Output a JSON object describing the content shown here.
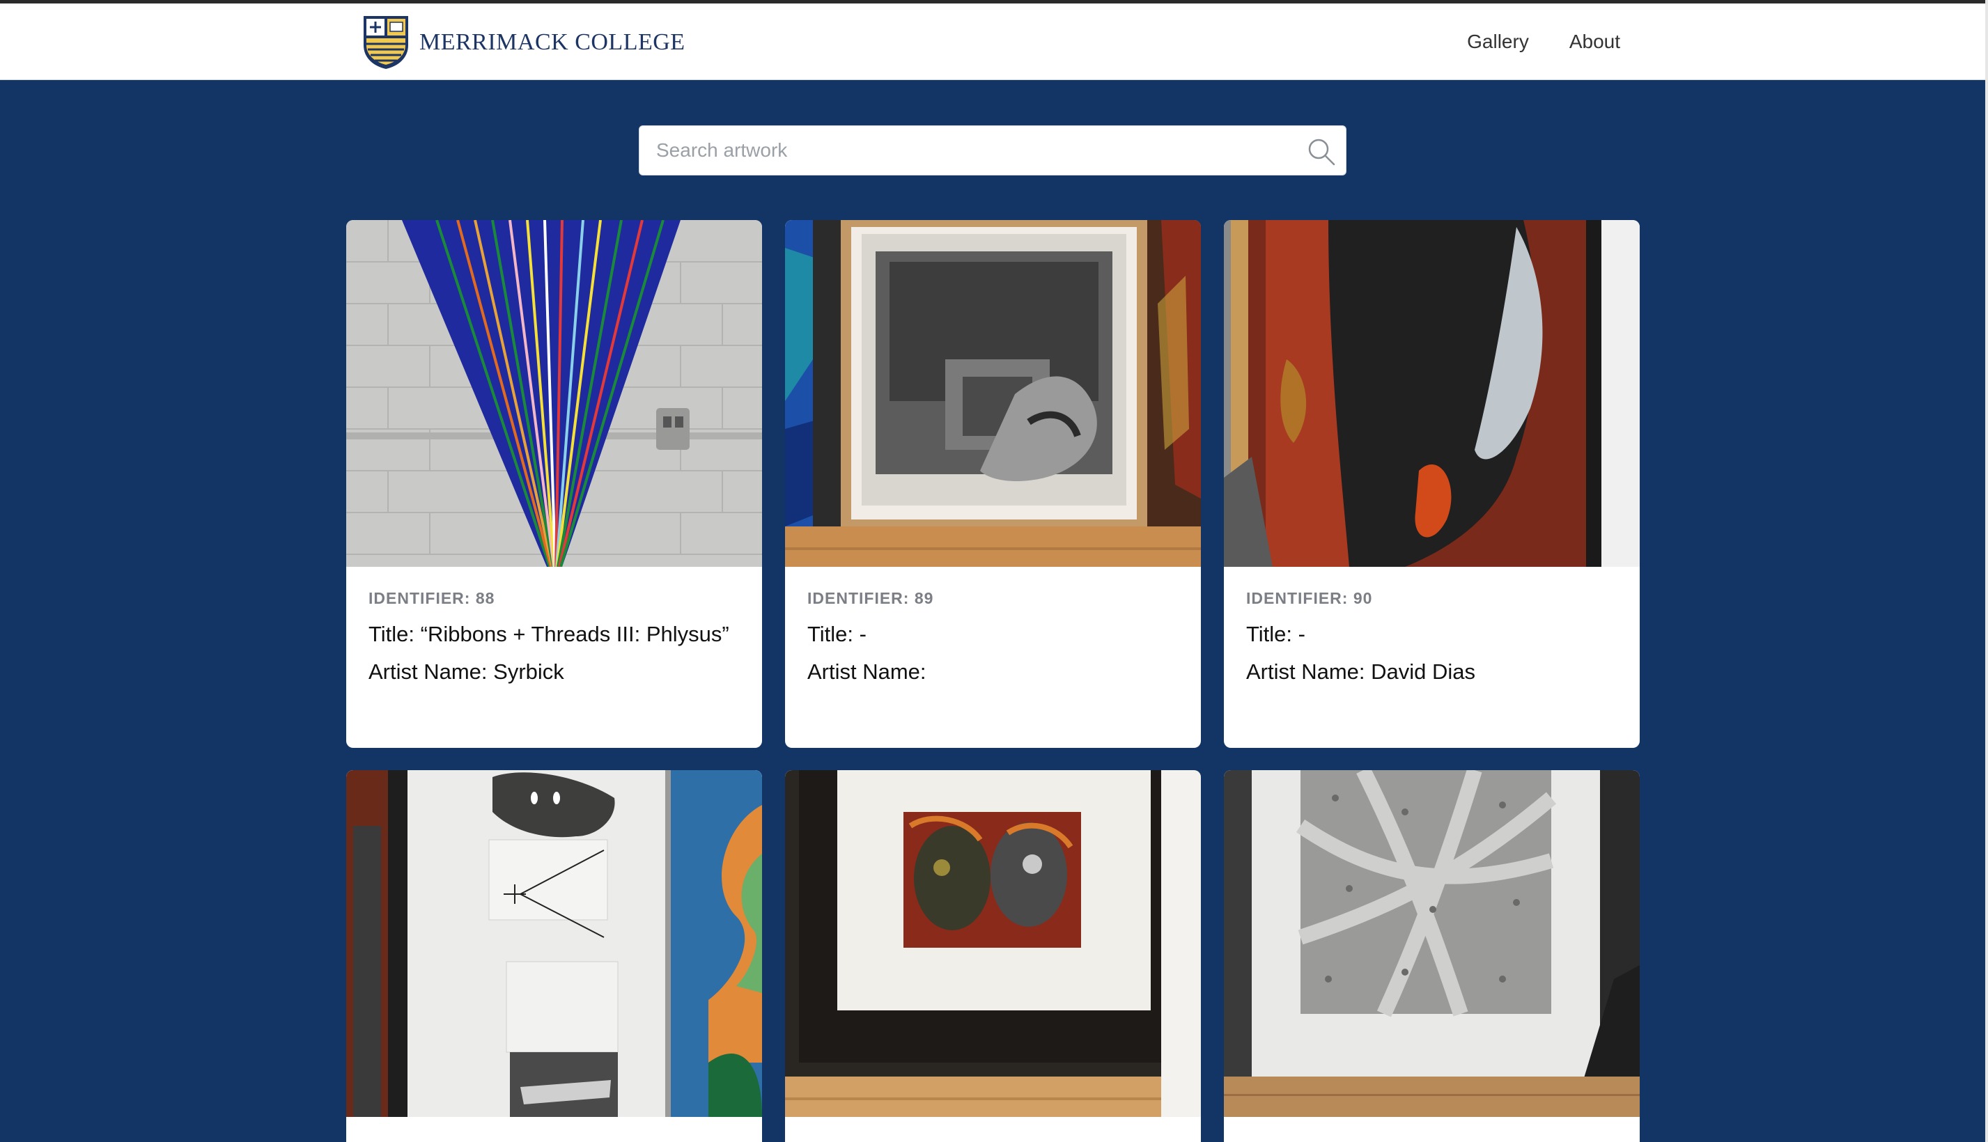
{
  "header": {
    "brand": "MERRIMACK COLLEGE",
    "logo_icon": "merrimack-shield-icon",
    "nav": [
      {
        "label": "Gallery"
      },
      {
        "label": "About"
      }
    ]
  },
  "search": {
    "placeholder": "Search artwork",
    "value": "",
    "icon": "search-icon"
  },
  "cards": [
    {
      "identifier": "IDENTIFIER: 88",
      "title": "Title: “Ribbons + Threads III: Phlysus”",
      "artist": "Artist Name: Syrbick"
    },
    {
      "identifier": "IDENTIFIER: 89",
      "title": "Title: -",
      "artist": "Artist Name:"
    },
    {
      "identifier": "IDENTIFIER: 90",
      "title": "Title: -",
      "artist": "Artist Name: David Dias"
    },
    {
      "identifier": "",
      "title": "",
      "artist": ""
    },
    {
      "identifier": "",
      "title": "",
      "artist": ""
    },
    {
      "identifier": "",
      "title": "",
      "artist": ""
    }
  ],
  "colors": {
    "background": "#133565",
    "brand_text": "#1c3565",
    "card_bg": "#ffffff"
  }
}
